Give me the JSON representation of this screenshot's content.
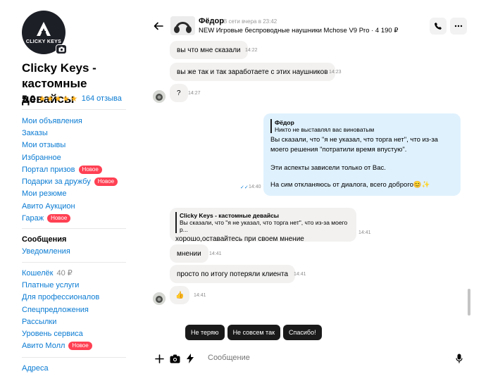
{
  "profile": {
    "avatar_text": "CLICKY KEYS",
    "shop_name": "Clicky Keys - кастомные девайсы",
    "rating": "5,0",
    "stars": "★★★★★",
    "reviews": "164 отзыва"
  },
  "menu_group1": [
    {
      "label": "Мои объявления"
    },
    {
      "label": "Заказы"
    },
    {
      "label": "Мои отзывы"
    },
    {
      "label": "Избранное"
    },
    {
      "label": "Портал призов",
      "badge": "Новое"
    },
    {
      "label": "Подарки за дружбу",
      "badge": "Новое"
    },
    {
      "label": "Мои резюме"
    },
    {
      "label": "Авито Аукцион"
    },
    {
      "label": "Гараж",
      "badge": "Новое"
    }
  ],
  "menu_group2": [
    {
      "label": "Сообщения",
      "bold": true
    },
    {
      "label": "Уведомления"
    }
  ],
  "menu_group3": [
    {
      "label": "Кошелёк",
      "amount": "40 ₽"
    },
    {
      "label": "Платные услуги"
    },
    {
      "label": "Для профессионалов"
    },
    {
      "label": "Спецпредложения"
    },
    {
      "label": "Рассылки"
    },
    {
      "label": "Уровень сервиса"
    },
    {
      "label": "Авито Молл",
      "badge": "Новое"
    }
  ],
  "menu_group4": [
    {
      "label": "Адреса"
    }
  ],
  "chat": {
    "name": "Фёдор",
    "status": "В сети вчера в 23:42",
    "item": "NEW Игровые беспроводные наушники Mchose V9 Pro · 4 190 ₽",
    "back_icon": "arrow-left-icon",
    "call_icon": "phone-icon",
    "more_icon": "more-dots-icon"
  },
  "messages": {
    "m1": {
      "text": "вы что мне сказали",
      "time": "14:22"
    },
    "m2": {
      "text": "вы же так и так заработаете с этих наушников",
      "time": "14:23"
    },
    "m3": {
      "text": "?",
      "time": "14:27"
    },
    "m4": {
      "quote_author": "Фёдор",
      "quote_text": "Никто не выставлял вас виноватым",
      "line1": "Вы сказали, что \"я не указал, что торга нет\", что из-за",
      "line2": "моего решения \"потратили время впустую\".",
      "line3": "Эти аспекты зависели только от Вас.",
      "line4": "На сим откланяюсь от диалога, всего доброго😊✨",
      "time": "14:40"
    },
    "m5": {
      "quote_author": "Clicky Keys - кастомные девайсы",
      "quote_text": "Вы сказали, что \"я не указал, что торга нет\", что из-за моего р...",
      "text": "хорошо,оставайтесь при своем мнение",
      "time": "14:41"
    },
    "m6": {
      "text": "мнении",
      "time": "14:41"
    },
    "m7": {
      "text": "просто по итогу потеряли клиента",
      "time": "14:41"
    },
    "m8": {
      "text": "👍",
      "time": "14:41"
    }
  },
  "quick_replies": [
    "Не теряю",
    "Не совсем так",
    "Спасибо!"
  ],
  "composer": {
    "placeholder": "Сообщение"
  },
  "colors": {
    "link": "#0a7bd3",
    "badge": "#ff4053",
    "outgoing_bubble": "#dff1fd",
    "incoming_bubble": "#f2f1f0",
    "star": "#ffb21e"
  }
}
